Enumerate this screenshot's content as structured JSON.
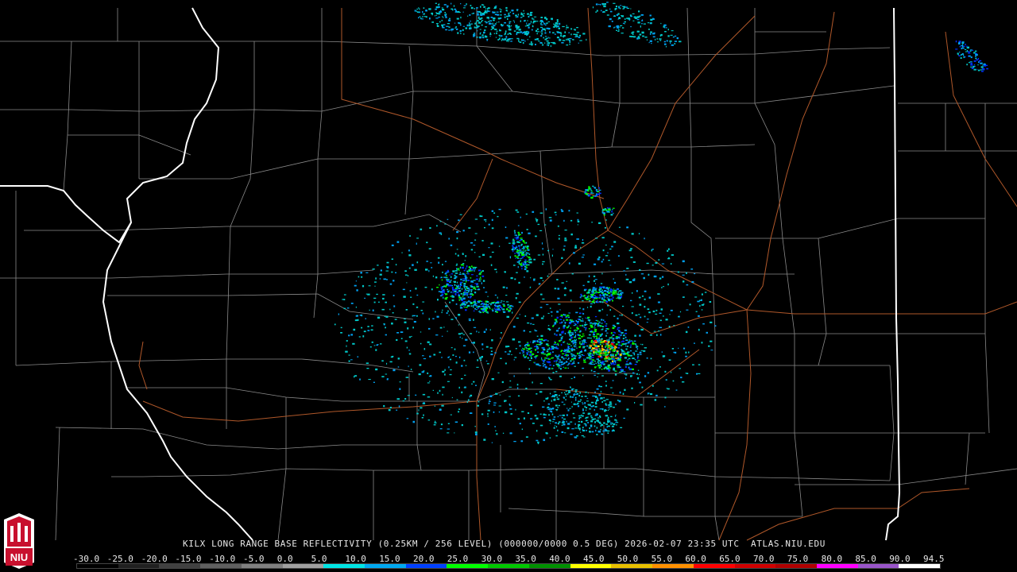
{
  "product": {
    "caption": "KILX LONG RANGE BASE REFLECTIVITY (0.25KM / 256 LEVEL) (000000/0000 0.5 DEG) 2026-02-07 23:35 UTC  ATLAS.NIU.EDU"
  },
  "logo": {
    "text": "NIU",
    "colors": {
      "red": "#c8102e",
      "white": "#ffffff"
    }
  },
  "legend": {
    "tick_labels": [
      "-30.0",
      "-25.0",
      "-20.0",
      "-15.0",
      "-10.0",
      "-5.0",
      "0.0",
      "5.0",
      "10.0",
      "15.0",
      "20.0",
      "25.0",
      "30.0",
      "35.0",
      "40.0",
      "45.0",
      "50.0",
      "55.0",
      "60.0",
      "65.0",
      "70.0",
      "75.0",
      "80.0",
      "85.0",
      "90.0",
      "94.5"
    ],
    "colors": [
      "#000000",
      "#202020",
      "#404040",
      "#606060",
      "#808080",
      "#a0a0a0",
      "#00e5e5",
      "#00a8f0",
      "#0040ff",
      "#00ff00",
      "#00c800",
      "#009000",
      "#ffff00",
      "#e8c000",
      "#ff9000",
      "#ff0000",
      "#d00000",
      "#b00000",
      "#ff00ff",
      "#9955c9",
      "#ffffff"
    ]
  },
  "map": {
    "state_border_color": "#ffffff",
    "county_line_color": "#8a8a8a",
    "highway_color": "#b0582a",
    "echo_colors": [
      "#00c8c8",
      "#00a0f0",
      "#0030ff",
      "#00ff00",
      "#009000",
      "#ffff00",
      "#ff9000",
      "#ff0000"
    ]
  }
}
